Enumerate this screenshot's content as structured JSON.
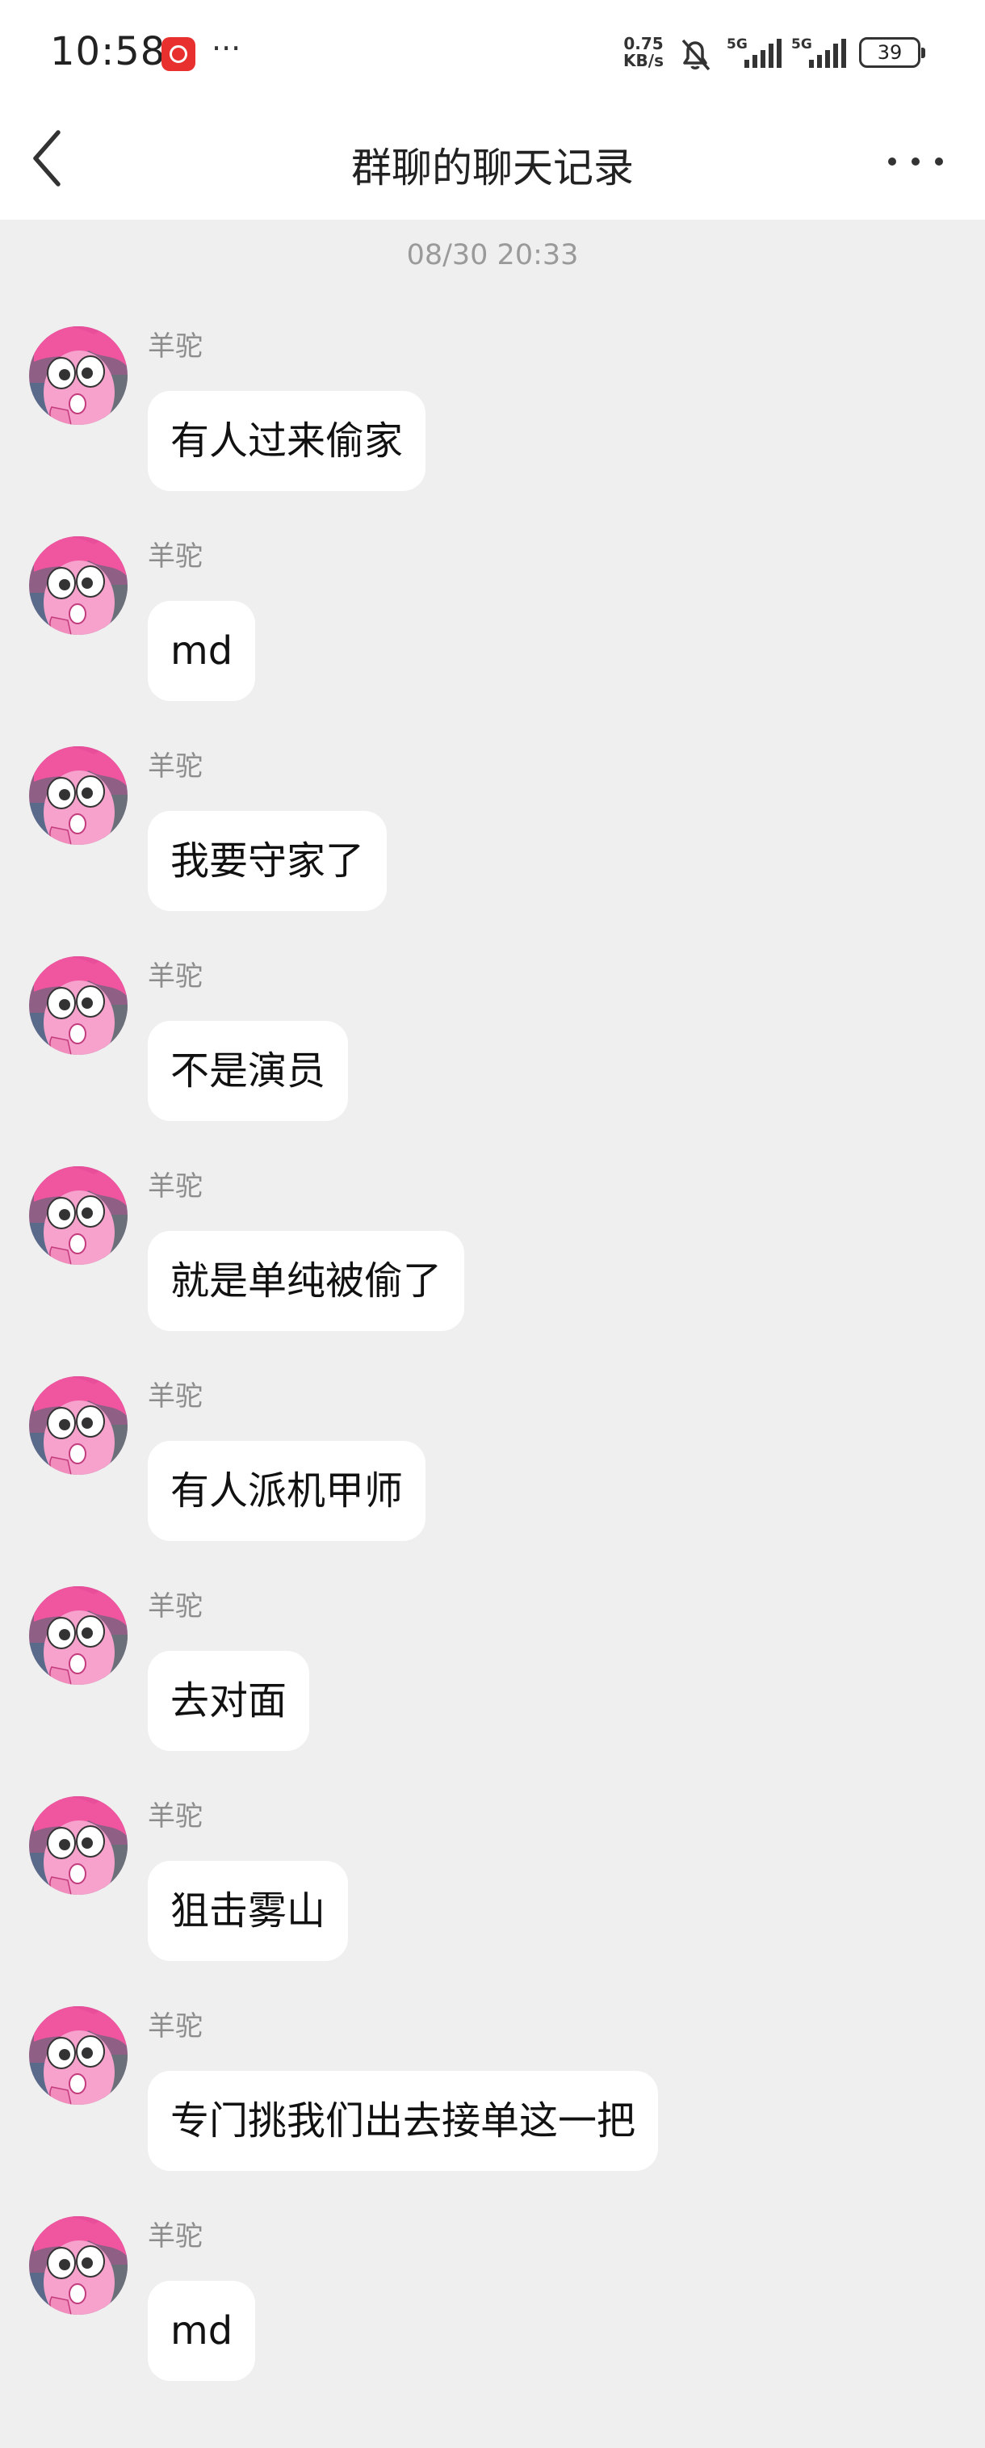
{
  "status_bar": {
    "time": "10:58",
    "more": "···",
    "net_speed_value": "0.75",
    "net_speed_unit": "KB/s",
    "signal_label": "5G",
    "battery": "39",
    "app_icon": "netease-music-icon",
    "bell_icon": "bell-off-icon",
    "signal_icon": "cellular-signal-icon"
  },
  "header": {
    "title": "群聊的聊天记录",
    "back_icon": "chevron-left-icon",
    "more_icon": "more-horizontal-icon"
  },
  "chat": {
    "timestamp": "08/30 20:33",
    "messages": [
      {
        "sender": "羊驼",
        "text": "有人过来偷家"
      },
      {
        "sender": "羊驼",
        "text": "md"
      },
      {
        "sender": "羊驼",
        "text": "我要守家了"
      },
      {
        "sender": "羊驼",
        "text": "不是演员"
      },
      {
        "sender": "羊驼",
        "text": "就是单纯被偷了"
      },
      {
        "sender": "羊驼",
        "text": "有人派机甲师"
      },
      {
        "sender": "羊驼",
        "text": "去对面"
      },
      {
        "sender": "羊驼",
        "text": "狙击雾山"
      },
      {
        "sender": "羊驼",
        "text": "专门挑我们出去接单这一把"
      },
      {
        "sender": "羊驼",
        "text": "md"
      }
    ]
  },
  "colors": {
    "background": "#efefef",
    "bubble": "#ffffff",
    "avatar_pink": "#f36fb0"
  }
}
